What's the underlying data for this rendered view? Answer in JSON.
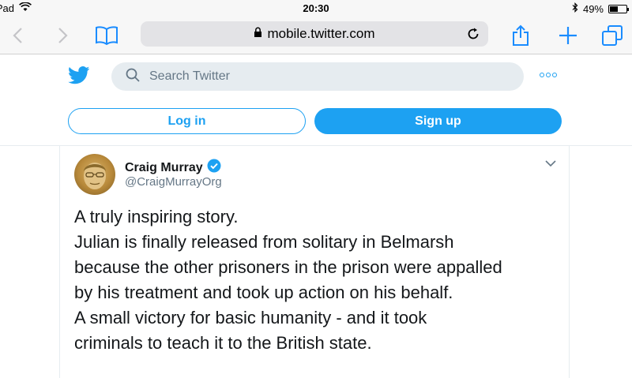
{
  "status_bar": {
    "device": "iPad",
    "time": "20:30",
    "battery": "49%",
    "battery_level": 0.49
  },
  "browser": {
    "url": "mobile.twitter.com",
    "icons": [
      "back-icon",
      "forward-icon",
      "bookmarks-icon",
      "lock-icon",
      "reload-icon",
      "share-icon",
      "new-tab-icon",
      "tabs-icon"
    ]
  },
  "header": {
    "search_placeholder": "Search Twitter",
    "login_label": "Log in",
    "signup_label": "Sign up"
  },
  "tweet": {
    "author_name": "Craig Murray",
    "author_handle": "@CraigMurrayOrg",
    "verified": true,
    "lines": [
      "A truly inspiring story.",
      "Julian is finally released from solitary in Belmarsh",
      "because the other prisoners in the prison were appalled",
      "by his treatment and took up action on his behalf.",
      "A small victory for basic humanity - and it took",
      "criminals to teach it to the British state."
    ]
  },
  "colors": {
    "accent": "#1da1f2",
    "safari_blue": "#1a8cff",
    "text": "#14171a",
    "muted": "#657786"
  }
}
